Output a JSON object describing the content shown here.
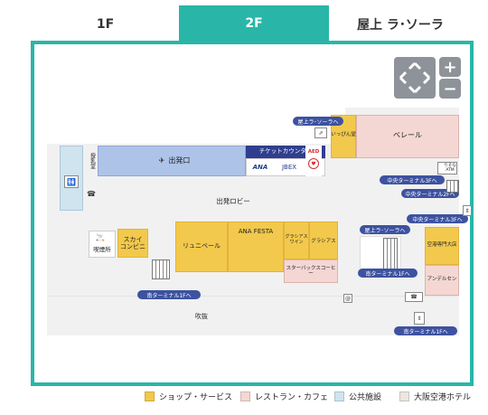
{
  "tabs": [
    {
      "label": "1F"
    },
    {
      "label": "2F"
    },
    {
      "label": "屋上 ラ･ソーラ"
    }
  ],
  "areas": {
    "departure_gate": "出発口",
    "departure_lobby": "出発ロビー",
    "atrium": "吹抜",
    "smoking_room": "喫煙所",
    "toilet": "授乳室"
  },
  "shops": {
    "sky_conveni": "スカイ\nコンビニ",
    "renewal": "リュニベール",
    "ana_festa": "ANA FESTA",
    "glacias_wine": "グラシアス\nワイン",
    "glacias": "グラシアス",
    "ippin": "いっぴん堂",
    "airport_store": "空港専門大店"
  },
  "restaurants": {
    "velle": "ベレール",
    "starbucks": "スターバックスコーヒー",
    "andersen": "アンデルセン"
  },
  "counters": {
    "ticket": "チケットカウンター",
    "ana": "ANA",
    "jbex": "JBEX"
  },
  "pills": {
    "roof_1": "屋上ラ･ソーラへ",
    "roof_2": "屋上ラ･ソーラへ",
    "central_3f": "中央ターミナル3Fへ",
    "central_2f": "中央ターミナル2Fへ",
    "central_3f_b": "中央ターミナル3Fへ",
    "south_1f_a": "南ターミナル1Fへ",
    "south_1f_b": "南ターミナル1Fへ",
    "south_1f_c": "南ターミナル1Fへ"
  },
  "misc": {
    "atm": "りそな\nATM",
    "aed": "AED"
  },
  "controls": {
    "plus": "+",
    "minus": "−"
  },
  "legend": [
    {
      "label": "ショップ・サービス",
      "color": "#f2c94c"
    },
    {
      "label": "レストラン・カフェ",
      "color": "#f4d7d3"
    },
    {
      "label": "公共施設",
      "color": "#cfe4ee"
    },
    {
      "label": "大阪空港ホテル",
      "color": "#ece7de"
    }
  ]
}
